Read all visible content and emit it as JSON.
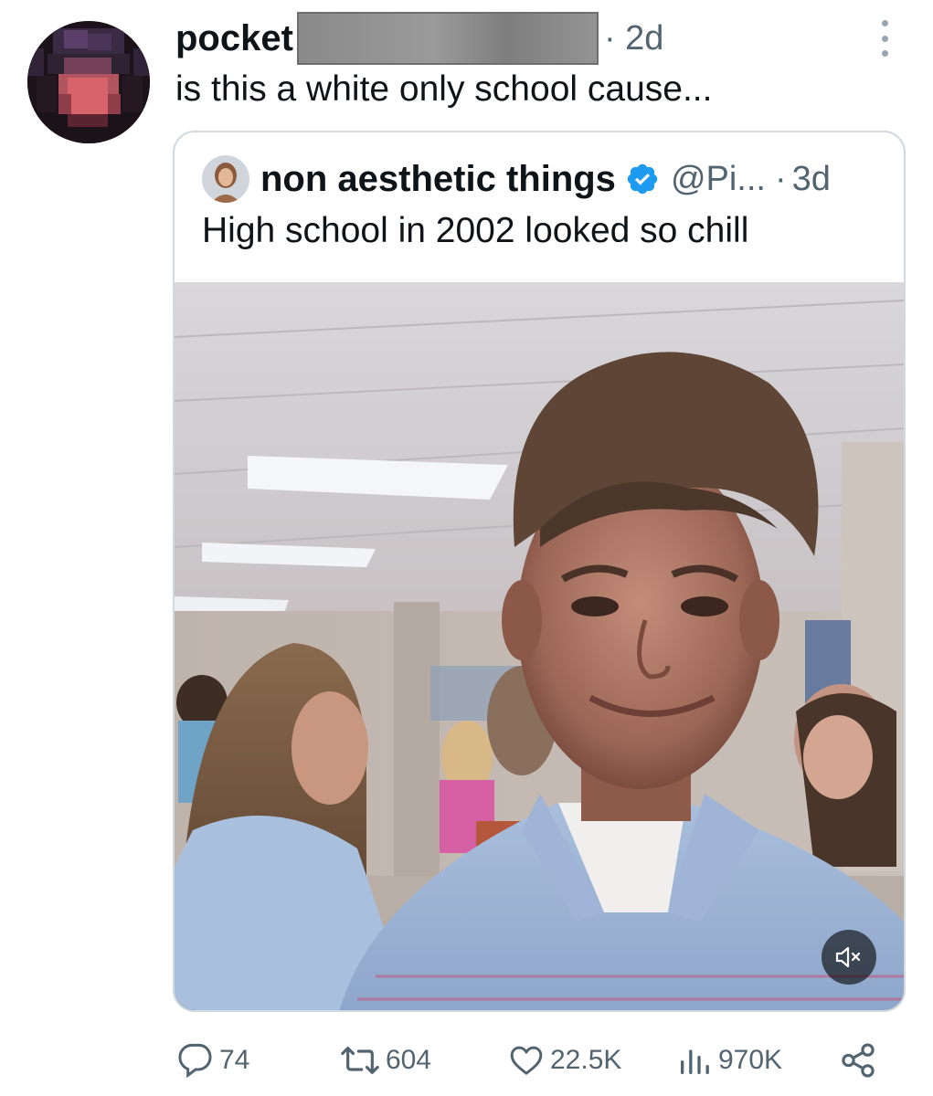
{
  "tweet": {
    "author": "pocket",
    "time": "· 2d",
    "text": "is this a white only school cause..."
  },
  "quote": {
    "author": "non aesthetic things",
    "handle": "@Pi...",
    "separator": "·",
    "time": "3d",
    "text": "High school in 2002 looked so chill"
  },
  "actions": {
    "replies": "74",
    "reposts": "604",
    "likes": "22.5K",
    "views": "970K"
  },
  "icons": {
    "reply": "reply-icon",
    "repost": "repost-icon",
    "like": "heart-icon",
    "views": "views-icon",
    "share": "share-icon",
    "mute": "muted-speaker-icon",
    "verified": "verified-badge-icon",
    "more": "more-vertical-icon"
  },
  "colors": {
    "text_primary": "#0f1419",
    "text_secondary": "#536471",
    "verified": "#1d9bf0",
    "border": "#cfd9de"
  }
}
